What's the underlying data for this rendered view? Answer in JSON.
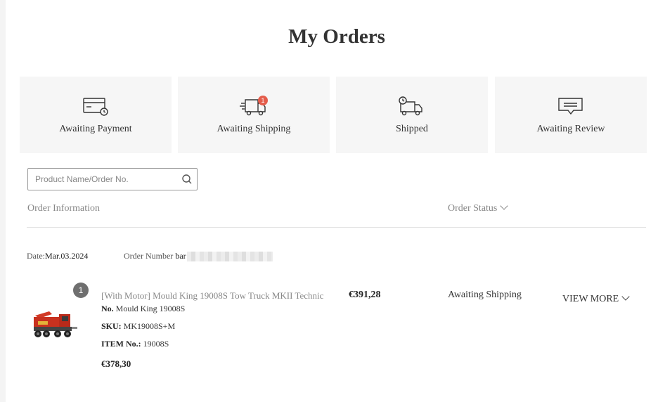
{
  "page": {
    "title": "My Orders"
  },
  "status_tabs": [
    {
      "label": "Awaiting Payment",
      "icon": "card-clock-icon"
    },
    {
      "label": "Awaiting Shipping",
      "icon": "truck-icon",
      "badge": "1"
    },
    {
      "label": "Shipped",
      "icon": "truck-clock-icon"
    },
    {
      "label": "Awaiting Review",
      "icon": "message-icon"
    }
  ],
  "search": {
    "placeholder": "Product Name/Order No.",
    "value": ""
  },
  "columns": {
    "info": "Order Information",
    "status": "Order Status"
  },
  "order": {
    "date_label": "Date:",
    "date": "Mar.03.2024",
    "number_label": "Order Number",
    "number": "bar",
    "quantity": "1",
    "product_name": "[With Motor] Mould King 19008S Tow Truck MKII Technic",
    "no_label": "No.",
    "no_value": "Mould King 19008S",
    "sku_label": "SKU:",
    "sku_value": "MK19008S+M",
    "item_label": "ITEM No.:",
    "item_value": "19008S",
    "unit_price": "€378,30",
    "total_price": "€391,28",
    "status": "Awaiting Shipping",
    "view_more": "VIEW MORE"
  },
  "colors": {
    "badge": "#e45c4b",
    "card_bg": "#f6f6f6",
    "truck_red": "#c8311f"
  }
}
